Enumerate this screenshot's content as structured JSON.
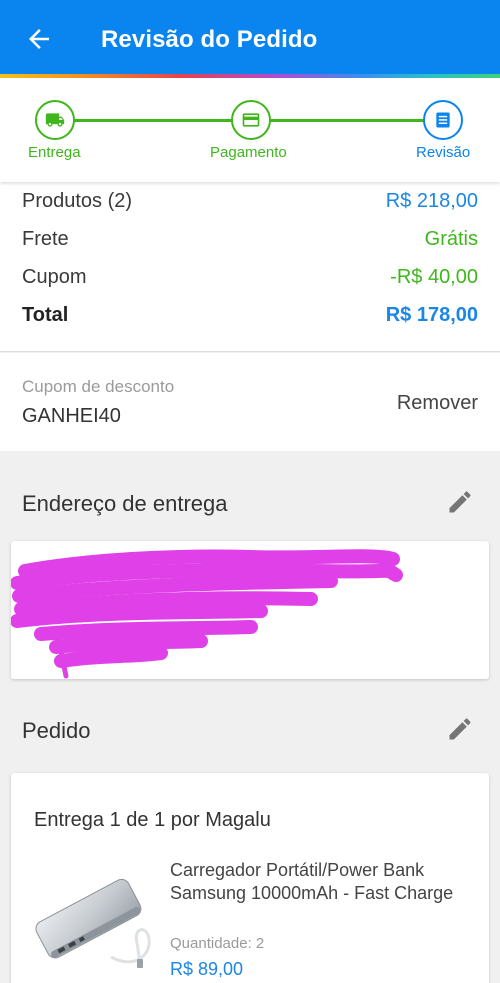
{
  "header": {
    "title": "Revisão do Pedido",
    "back_icon": "arrow-left-icon",
    "background": "#0a84ee"
  },
  "steps": [
    {
      "label": "Entrega",
      "icon": "truck-icon",
      "state": "done"
    },
    {
      "label": "Pagamento",
      "icon": "credit-card-icon",
      "state": "done"
    },
    {
      "label": "Revisão",
      "icon": "list-icon",
      "state": "active"
    }
  ],
  "summary": {
    "products_label": "Produtos (2)",
    "products_value": "R$ 218,00",
    "shipping_label": "Frete",
    "shipping_value": "Grátis",
    "coupon_label": "Cupom",
    "coupon_value": "-R$ 40,00",
    "total_label": "Total",
    "total_value": "R$ 178,00"
  },
  "coupon": {
    "label": "Cupom de desconto",
    "code": "GANHEI40",
    "remove_label": "Remover"
  },
  "address": {
    "title": "Endereço de entrega",
    "edit_icon": "pencil-icon",
    "redacted": true
  },
  "order": {
    "title": "Pedido",
    "edit_icon": "pencil-icon",
    "delivery_label": "Entrega 1 de 1 por Magalu",
    "product": {
      "name": "Carregador Portátil/Power Bank Samsung 10000mAh - Fast Charge",
      "quantity_label": "Quantidade:  2",
      "price": "R$ 89,00",
      "image": "power-bank-image"
    }
  },
  "colors": {
    "primary": "#0a84ee",
    "success": "#3fb61c",
    "redaction": "#e040e8"
  }
}
